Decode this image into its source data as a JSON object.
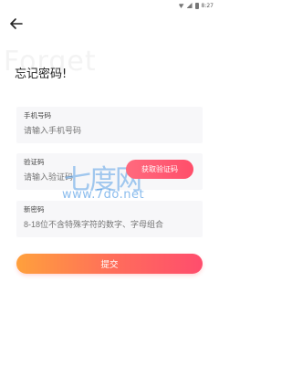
{
  "status_bar": {
    "time": "8:27"
  },
  "page": {
    "title": "忘记密码!",
    "watermark_text": "Forget"
  },
  "fields": {
    "phone": {
      "label": "手机号码",
      "placeholder": "请输入手机号码"
    },
    "code": {
      "label": "验证码",
      "placeholder": "请输入验证码"
    },
    "password": {
      "label": "新密码",
      "placeholder": "8-18位不含特殊字符的数字、字母组合"
    }
  },
  "buttons": {
    "get_code": "获取验证码",
    "submit": "提交"
  },
  "site_watermark": {
    "logo_text": "七度网",
    "url": "www.7do.net"
  },
  "colors": {
    "accent_start": "#ffa03c",
    "accent_end": "#ff4d6d",
    "code_button": "#ff5a72",
    "field_bg": "#f7f7f9",
    "watermark_blue": "#5aa0e6"
  }
}
